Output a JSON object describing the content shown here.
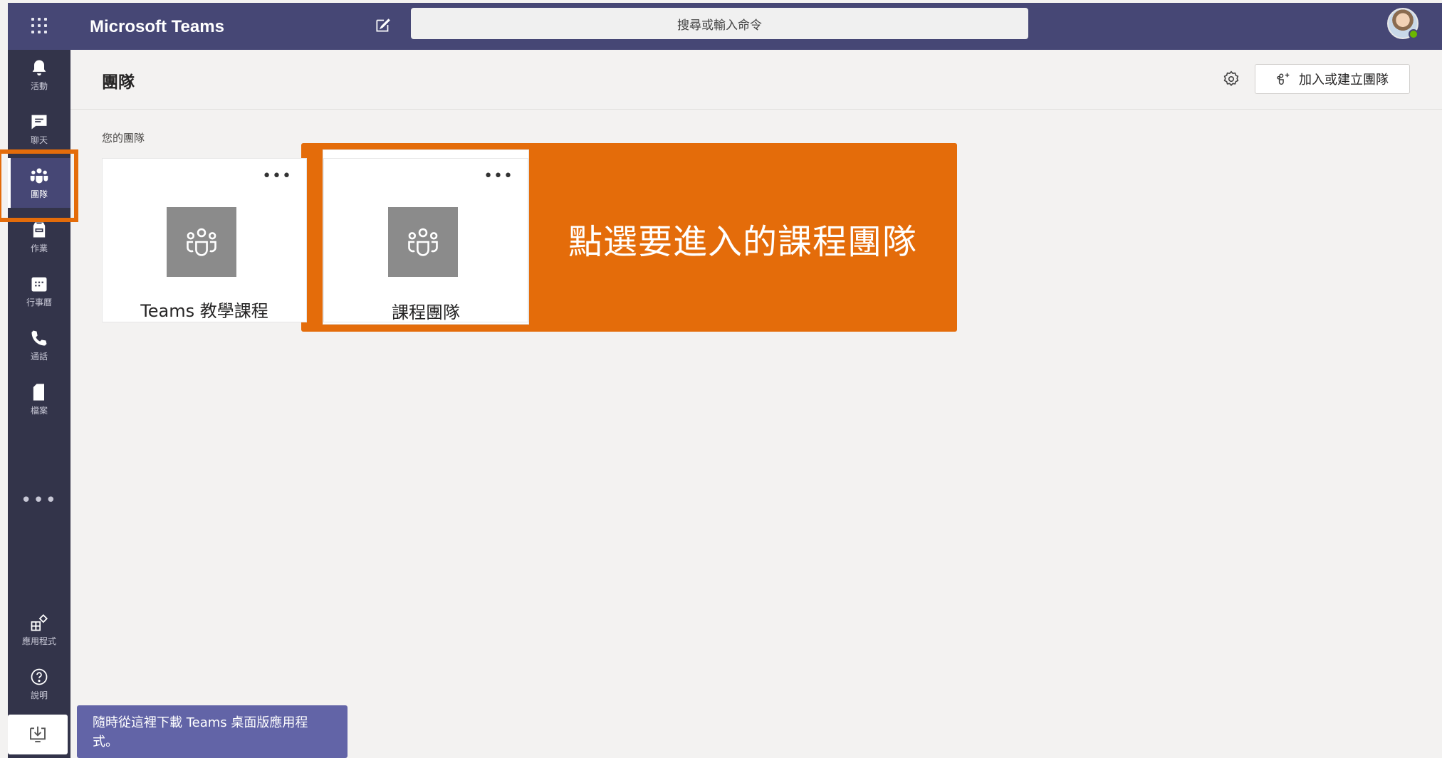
{
  "app": {
    "title": "Microsoft Teams"
  },
  "search": {
    "placeholder": "搜尋或輸入命令"
  },
  "rail": {
    "items": [
      {
        "label": "活動",
        "icon": "bell-icon"
      },
      {
        "label": "聊天",
        "icon": "chat-icon"
      },
      {
        "label": "團隊",
        "icon": "teams-icon",
        "active": true
      },
      {
        "label": "作業",
        "icon": "assignments-icon"
      },
      {
        "label": "行事曆",
        "icon": "calendar-icon"
      },
      {
        "label": "通話",
        "icon": "phone-icon"
      },
      {
        "label": "檔案",
        "icon": "file-icon"
      }
    ],
    "more": "•••",
    "bottom": [
      {
        "label": "應用程式",
        "icon": "apps-icon"
      },
      {
        "label": "說明",
        "icon": "help-icon"
      }
    ]
  },
  "header": {
    "title": "團隊",
    "join_button": "加入或建立團隊"
  },
  "section": {
    "label": "您的團隊"
  },
  "teams": [
    {
      "name": "Teams 教學課程",
      "more": "•••"
    },
    {
      "name": "課程團隊",
      "more": "•••"
    }
  ],
  "callout": {
    "text": "點選要進入的課程團隊",
    "color": "#e46c0a"
  },
  "toast": {
    "text": "隨時從這裡下載 Teams 桌面版應用程式。"
  },
  "colors": {
    "topbar": "#464775",
    "rail": "#33344a",
    "accent": "#6264a7",
    "highlight": "#e46c0a"
  }
}
